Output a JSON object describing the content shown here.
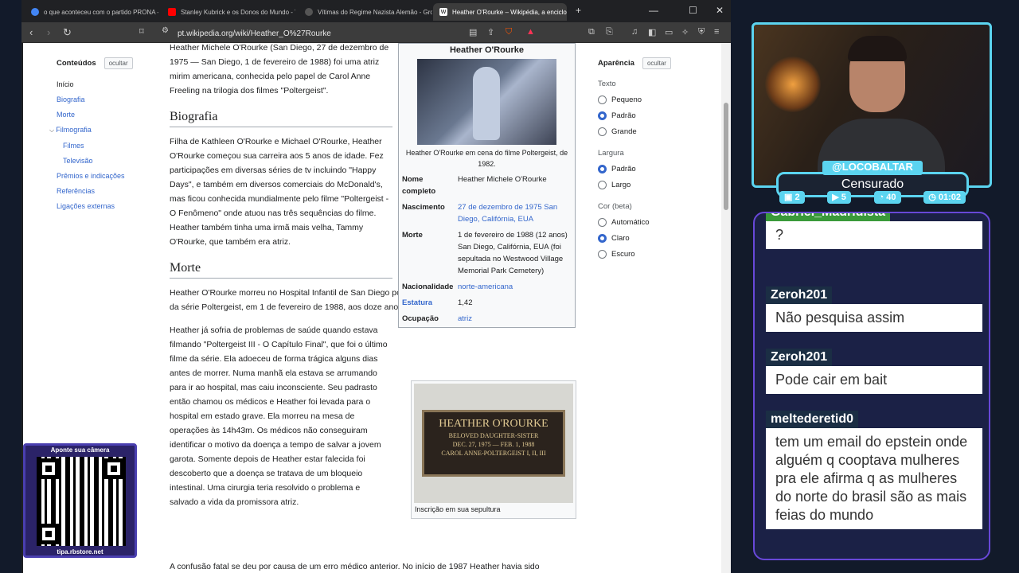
{
  "tabs": [
    {
      "label": "o que aconteceu com o partido PRONA - Pe",
      "color": "#4285f4"
    },
    {
      "label": "Stanley Kubrick e os Donos do Mundo - You",
      "color": "#ff0000"
    },
    {
      "label": "Vítimas do Regime Nazista Alemão - Grok",
      "color": "#555555"
    },
    {
      "label": "Heather O'Rourke – Wikipédia, a enciclo",
      "color": "#ffffff"
    }
  ],
  "address": "pt.wikipedia.org/wiki/Heather_O%27Rourke",
  "ext_badge": "2",
  "toc": {
    "title": "Conteúdos",
    "hide": "ocultar",
    "items": [
      "Início",
      "Biografia",
      "Morte",
      "Filmografia",
      "Filmes",
      "Televisão",
      "Prêmios e indicações",
      "Referências",
      "Ligações externas"
    ]
  },
  "article": {
    "intro": "Heather Michele O'Rourke (San Diego, 27 de dezembro de 1975 — San Diego, 1 de fevereiro de 1988) foi uma atriz mirim americana, conhecida pelo papel de Carol Anne Freeling na trilogia dos filmes \"Poltergeist\".",
    "h_bio": "Biografia",
    "bio": "Filha de Kathleen O'Rourke e Michael O'Rourke, Heather O'Rourke começou sua carreira aos 5 anos de idade. Fez participações em diversas séries de tv incluindo \"Happy Days\", e também em diversos comerciais do McDonald's, mas ficou conhecida mundialmente pelo filme \"Poltergeist - O Fenômeno\" onde atuou nas três sequências do filme. Heather também tinha uma irmã mais velha, Tammy O'Rourke, que também era atriz.",
    "h_morte": "Morte",
    "morte1": "Heather O'Rourke morreu no Hospital Infantil de San Diego pouco antes do lançamento do terceiro filme da série Poltergeist, em 1 de fevereiro de 1988, aos doze anos.",
    "morte2": "Heather já sofria de problemas de saúde quando estava filmando \"Poltergeist III - O Capítulo Final\", que foi o último filme da série. Ela adoeceu de forma trágica alguns dias antes de morrer. Numa manhã ela estava se arrumando para ir ao hospital, mas caiu inconsciente. Seu padrasto então chamou os médicos e Heather foi levada para o hospital em estado grave. Ela morreu na mesa de operações às 14h43m. Os médicos não conseguiram identificar o motivo da doença a tempo de salvar a jovem garota. Somente depois de Heather estar falecida foi descoberto que a doença se tratava de um bloqueio intestinal. Uma cirurgia teria resolvido o problema e salvado a vida da promissora atriz.",
    "morte3": "A confusão fatal se deu por causa de um erro médico anterior. No início de 1987 Heather havia sido"
  },
  "infobox": {
    "title": "Heather O'Rourke",
    "caption": "Heather O'Rourke em cena do filme Poltergeist, de 1982.",
    "rows": [
      {
        "k": "Nome completo",
        "v": "Heather Michele O'Rourke"
      },
      {
        "k": "Nascimento",
        "v": "27 de dezembro de 1975 San Diego, Califórnia, EUA"
      },
      {
        "k": "Morte",
        "v": "1 de fevereiro de 1988 (12 anos) San Diego, Califórnia, EUA (foi sepultada no Westwood Village Memorial Park Cemetery)"
      },
      {
        "k": "Nacionalidade",
        "v": "norte-americana"
      },
      {
        "k": "Estatura",
        "v": "1,42"
      },
      {
        "k": "Ocupação",
        "v": "atriz"
      }
    ]
  },
  "plaque": {
    "name": "HEATHER O'ROURKE",
    "l2": "BELOVED DAUGHTER-SISTER",
    "l3": "DEC. 27, 1975 — FEB. 1, 1988",
    "l4": "CAROL ANNE-POLTERGEIST I, II, III",
    "caption": "Inscrição em sua sepultura"
  },
  "appearance": {
    "title": "Aparência",
    "hide": "ocultar",
    "text_label": "Texto",
    "text_opts": [
      "Pequeno",
      "Padrão",
      "Grande"
    ],
    "width_label": "Largura",
    "width_opts": [
      "Padrão",
      "Largo"
    ],
    "color_label": "Cor (beta)",
    "color_opts": [
      "Automático",
      "Claro",
      "Escuro"
    ]
  },
  "stream": {
    "handle": "@LOCOBALTAR",
    "status": "Censurado",
    "stats": [
      "2",
      "5",
      "40",
      "01:02"
    ]
  },
  "chat": [
    {
      "user": "Gabriel_Madridista",
      "msg": "?"
    },
    {
      "user": "Zeroh201",
      "msg": "Não pesquisa assim"
    },
    {
      "user": "Zeroh201",
      "msg": "Pode cair em bait"
    },
    {
      "user": "meltederetid0",
      "msg": "tem um email do epstein onde alguém q cooptava mulheres pra ele afirma q as mulheres do norte do brasil são as mais feias do mundo"
    }
  ],
  "qr": {
    "top": "Aponte sua câmera",
    "bottom": "tipa.rbstore.net"
  }
}
